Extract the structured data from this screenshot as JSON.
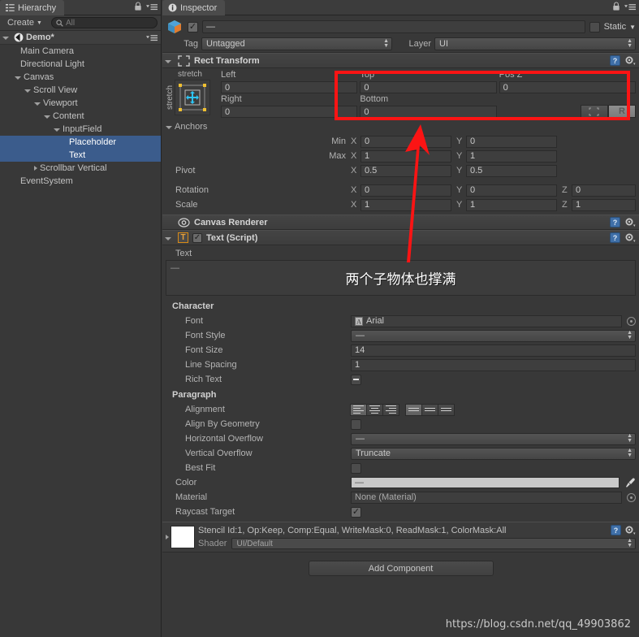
{
  "hierarchy": {
    "tab_label": "Hierarchy",
    "tab_icon": "hierarchy-icon",
    "lock_icon": "lock-icon",
    "menu_icon": "hamburger-menu-icon",
    "create_label": "Create",
    "search_placeholder": "All",
    "search_icon": "search-icon",
    "scene_name": "Demo*",
    "scene_icon": "unity-scene-icon",
    "items": [
      {
        "label": "Main Camera",
        "depth": 1,
        "arrow": "none",
        "selected": false
      },
      {
        "label": "Directional Light",
        "depth": 1,
        "arrow": "none",
        "selected": false
      },
      {
        "label": "Canvas",
        "depth": 1,
        "arrow": "expanded",
        "selected": false
      },
      {
        "label": "Scroll View",
        "depth": 2,
        "arrow": "expanded",
        "selected": false
      },
      {
        "label": "Viewport",
        "depth": 3,
        "arrow": "expanded",
        "selected": false
      },
      {
        "label": "Content",
        "depth": 4,
        "arrow": "expanded",
        "selected": false
      },
      {
        "label": "InputField",
        "depth": 5,
        "arrow": "expanded",
        "selected": false
      },
      {
        "label": "Placeholder",
        "depth": 6,
        "arrow": "none",
        "selected": true
      },
      {
        "label": "Text",
        "depth": 6,
        "arrow": "none",
        "selected": true
      },
      {
        "label": "Scrollbar Vertical",
        "depth": 3,
        "arrow": "collapsed",
        "selected": false
      },
      {
        "label": "EventSystem",
        "depth": 1,
        "arrow": "none",
        "selected": false
      }
    ]
  },
  "inspector": {
    "tab_label": "Inspector",
    "tab_icon": "info-icon",
    "lock_icon": "lock-icon",
    "menu_icon": "hamburger-menu-icon",
    "object_icon": "prefab-cube-icon",
    "enabled_checkbox": "checked",
    "name_value": "—",
    "static_label": "Static",
    "static_checked": false,
    "tag_label": "Tag",
    "tag_value": "Untagged",
    "layer_label": "Layer",
    "layer_value": "UI"
  },
  "rect_transform": {
    "title": "Rect Transform",
    "icon": "rect-transform-icon",
    "help_icon": "help-icon",
    "gear_icon": "gear-icon",
    "preset_label_top": "stretch",
    "preset_label_side": "stretch",
    "fields": {
      "left_label": "Left",
      "left_value": "0",
      "top_label": "Top",
      "top_value": "0",
      "posz_label": "Pos Z",
      "posz_value": "0",
      "right_label": "Right",
      "right_value": "0",
      "bottom_label": "Bottom",
      "bottom_value": "0"
    },
    "blueprint_icon": "blueprint-mode-icon",
    "rawedit_icon": "raw-edit-mode-icon",
    "anchors_label": "Anchors",
    "min_label": "Min",
    "min_x": "0",
    "min_y": "0",
    "max_label": "Max",
    "max_x": "1",
    "max_y": "1",
    "pivot_label": "Pivot",
    "pivot_x": "0.5",
    "pivot_y": "0.5",
    "rotation_label": "Rotation",
    "rot_x": "0",
    "rot_y": "0",
    "rot_z": "0",
    "scale_label": "Scale",
    "scale_x": "1",
    "scale_y": "1",
    "scale_z": "1",
    "axis_x": "X",
    "axis_y": "Y",
    "axis_z": "Z"
  },
  "canvas_renderer": {
    "title": "Canvas Renderer",
    "icon": "canvas-renderer-icon",
    "help_icon": "help-icon",
    "gear_icon": "gear-icon"
  },
  "text_component": {
    "title": "Text (Script)",
    "icon": "text-script-icon",
    "enabled_checkbox": "checked",
    "help_icon": "help-icon",
    "gear_icon": "gear-icon",
    "text_label": "Text",
    "text_value": "两个子物体也撑满",
    "text_placeholder_dash": "—",
    "character_section": "Character",
    "font_label": "Font",
    "font_value": "Arial",
    "font_icon": "font-asset-icon",
    "font_picker_icon": "object-picker-icon",
    "font_style_label": "Font Style",
    "font_style_value": "—",
    "font_size_label": "Font Size",
    "font_size_value": "14",
    "line_spacing_label": "Line Spacing",
    "line_spacing_value": "1",
    "rich_text_label": "Rich Text",
    "rich_text_state": "mixed",
    "paragraph_section": "Paragraph",
    "alignment_label": "Alignment",
    "align_h_selected": 0,
    "align_v_selected": 0,
    "align_by_geometry_label": "Align By Geometry",
    "align_by_geometry_checked": false,
    "horizontal_overflow_label": "Horizontal Overflow",
    "horizontal_overflow_value": "—",
    "vertical_overflow_label": "Vertical Overflow",
    "vertical_overflow_value": "Truncate",
    "best_fit_label": "Best Fit",
    "best_fit_checked": false,
    "color_label": "Color",
    "color_value_hex": "#c9c9c9",
    "color_dash": "—",
    "eyedropper_icon": "eyedropper-icon",
    "material_label": "Material",
    "material_value": "None (Material)",
    "material_picker_icon": "object-picker-icon",
    "raycast_target_label": "Raycast Target",
    "raycast_target_checked": true
  },
  "material_block": {
    "title": "Stencil Id:1, Op:Keep, Comp:Equal, WriteMask:0, ReadMask:1, ColorMask:All",
    "shader_label": "Shader",
    "shader_value": "UI/Default",
    "expand_arrow": "collapsed-triangle-icon",
    "help_icon": "help-icon",
    "gear_icon": "gear-icon",
    "swatch_icon": "material-preview-swatch"
  },
  "footer": {
    "add_component_label": "Add Component",
    "watermark": "https://blog.csdn.net/qq_49903862"
  },
  "annotations": {
    "red_box_color": "#fb1414",
    "red_arrow_color": "#fb1414",
    "red_box_target": "rect-transform-left-top-right-bottom-fields"
  }
}
